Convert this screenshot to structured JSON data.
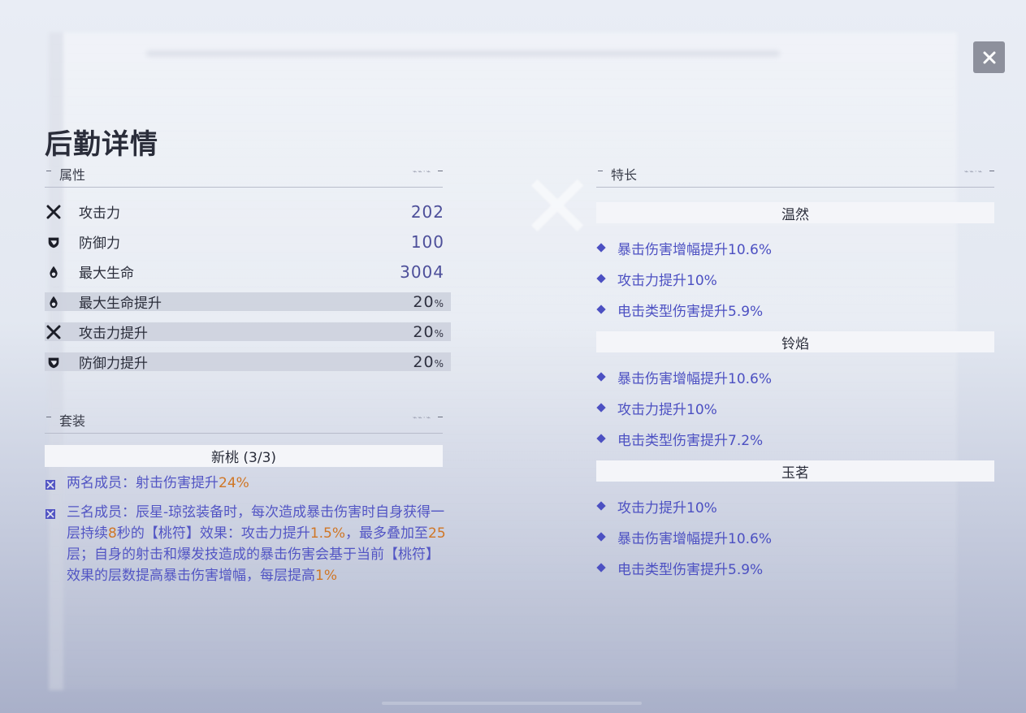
{
  "title": "后勤详情",
  "close_icon": "close-icon",
  "attributes": {
    "header": "属性",
    "rows": [
      {
        "icon": "crossed-swords-icon",
        "name": "攻击力",
        "value": "202",
        "highlight": false
      },
      {
        "icon": "shield-icon",
        "name": "防御力",
        "value": "100",
        "highlight": false
      },
      {
        "icon": "droplet-icon",
        "name": "最大生命",
        "value": "3004",
        "highlight": false
      },
      {
        "icon": "droplet-icon",
        "name": "最大生命提升",
        "value": "20",
        "unit": "%",
        "highlight": true
      },
      {
        "icon": "crossed-swords-icon",
        "name": "攻击力提升",
        "value": "20",
        "unit": "%",
        "highlight": true
      },
      {
        "icon": "shield-icon",
        "name": "防御力提升",
        "value": "20",
        "unit": "%",
        "highlight": true
      }
    ]
  },
  "set": {
    "header": "套装",
    "name": "新桃 (3/3)",
    "effects": [
      {
        "parts": [
          "两名成员：射击伤害提升",
          "24%"
        ]
      },
      {
        "parts": [
          "三名成员：辰星-琼弦装备时，每次造成暴击伤害时自身获得一层持续",
          "8",
          "秒的【桃符】效果：攻击力提升",
          "1.5%",
          "，最多叠加至",
          "25",
          "层；自身的射击和爆发技造成的暴击伤害会基于当前【桃符】效果的层数提高暴击伤害增幅，每层提高",
          "1%",
          ""
        ]
      }
    ]
  },
  "specialties": {
    "header": "特长",
    "groups": [
      {
        "name": "温然",
        "items": [
          "暴击伤害增幅提升10.6%",
          "攻击力提升10%",
          "电击类型伤害提升5.9%"
        ]
      },
      {
        "name": "铃焰",
        "items": [
          "暴击伤害增幅提升10.6%",
          "攻击力提升10%",
          "电击类型伤害提升7.2%"
        ]
      },
      {
        "name": "玉茗",
        "items": [
          "攻击力提升10%",
          "暴击伤害增幅提升10.6%",
          "电击类型伤害提升5.9%"
        ]
      }
    ]
  },
  "colors": {
    "accent": "#4c50c2",
    "highlight": "#d07625",
    "close_bg": "#8d909c"
  }
}
